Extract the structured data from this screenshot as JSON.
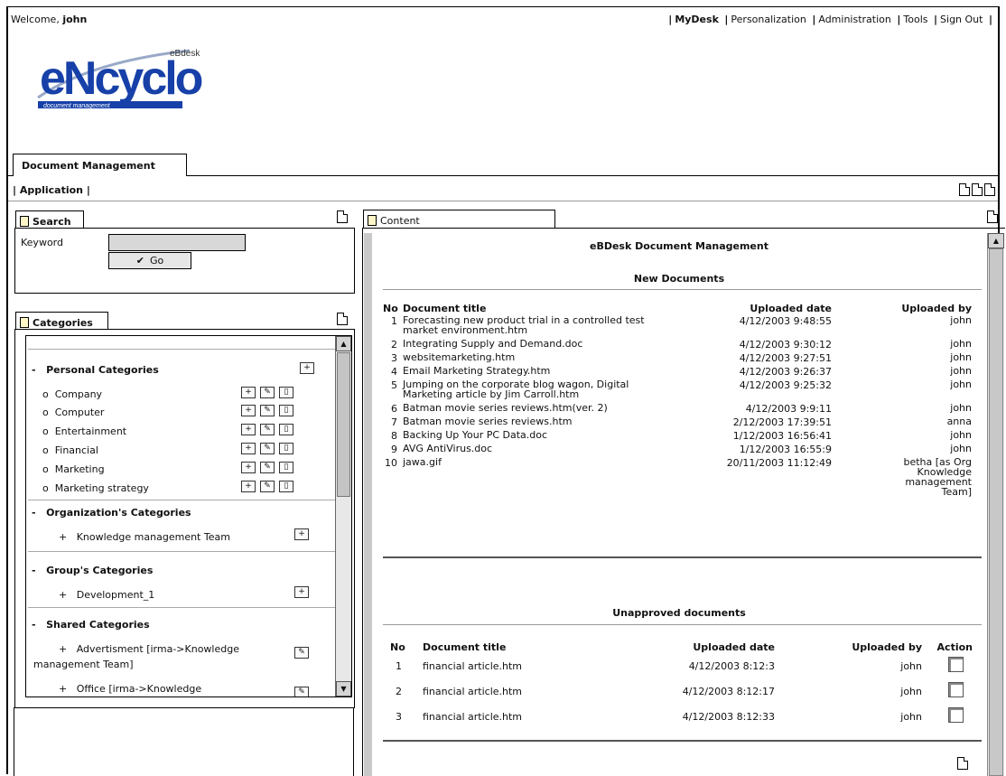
{
  "header": {
    "welcome_prefix": "Welcome,",
    "username": "john",
    "nav": [
      "MyDesk",
      "Personalization",
      "Administration",
      "Tools",
      "Sign Out"
    ]
  },
  "logo": {
    "main": "eNcyclo",
    "small": "eBdesk",
    "sub": "document management"
  },
  "tabs": {
    "main": "Document Management",
    "application": "| Application |"
  },
  "search": {
    "tab": "Search",
    "keyword_label": "Keyword",
    "keyword_value": "",
    "go_label": "Go"
  },
  "categories": {
    "tab": "Categories",
    "personal_title": "Personal Categories",
    "personal": [
      "Company",
      "Computer",
      "Entertainment",
      "Financial",
      "Marketing",
      "Marketing strategy"
    ],
    "org_title": "Organization's Categories",
    "org_item": "Knowledge management Team",
    "group_title": "Group's Categories",
    "group_item": "Development_1",
    "shared_title": "Shared Categories",
    "shared_1a": "Advertisment [irma->Knowledge",
    "shared_1b": "management Team]",
    "shared_2": "Office [irma->Knowledge"
  },
  "content": {
    "tab": "Content",
    "title": "eBDesk Document Management",
    "new_title": "New Documents",
    "cols": {
      "no": "No",
      "title": "Document title",
      "date": "Uploaded date",
      "by": "Uploaded by",
      "action": "Action"
    },
    "new_docs": [
      {
        "no": "1",
        "title": "Forecasting new product trial in a controlled test market environment.htm",
        "date": "4/12/2003 9:48:55",
        "by": "john"
      },
      {
        "no": "2",
        "title": "Integrating Supply and Demand.doc",
        "date": "4/12/2003 9:30:12",
        "by": "john"
      },
      {
        "no": "3",
        "title": "websitemarketing.htm",
        "date": "4/12/2003 9:27:51",
        "by": "john"
      },
      {
        "no": "4",
        "title": "Email Marketing Strategy.htm",
        "date": "4/12/2003 9:26:37",
        "by": "john"
      },
      {
        "no": "5",
        "title": "Jumping on the corporate blog wagon, Digital Marketing article by Jim Carroll.htm",
        "date": "4/12/2003 9:25:32",
        "by": "john"
      },
      {
        "no": "6",
        "title": "Batman movie series reviews.htm(ver. 2)",
        "date": "4/12/2003 9:9:11",
        "by": "john"
      },
      {
        "no": "7",
        "title": "Batman movie series reviews.htm",
        "date": "2/12/2003 17:39:51",
        "by": "anna"
      },
      {
        "no": "8",
        "title": "Backing Up Your PC Data.doc",
        "date": "1/12/2003 16:56:41",
        "by": "john"
      },
      {
        "no": "9",
        "title": "AVG AntiVirus.doc",
        "date": "1/12/2003 16:55:9",
        "by": "john"
      },
      {
        "no": "10",
        "title": "jawa.gif",
        "date": "20/11/2003 11:12:49",
        "by": "betha [as Org Knowledge management Team]"
      }
    ],
    "unapproved_title": "Unapproved documents",
    "unapproved": [
      {
        "no": "1",
        "title": "financial article.htm",
        "date": "4/12/2003 8:12:3",
        "by": "john"
      },
      {
        "no": "2",
        "title": "financial article.htm",
        "date": "4/12/2003 8:12:17",
        "by": "john"
      },
      {
        "no": "3",
        "title": "financial article.htm",
        "date": "4/12/2003 8:12:33",
        "by": "john"
      }
    ]
  },
  "colors": {
    "brand_blue": "#1740a8",
    "tab_icon": "#fff6c8"
  }
}
